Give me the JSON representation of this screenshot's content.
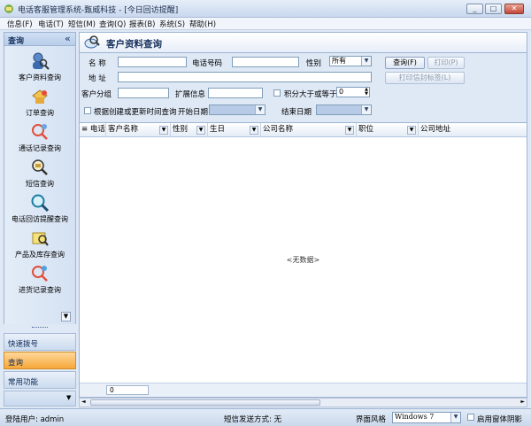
{
  "window": {
    "title": "电话客服管理系统-甄威科技 - [今日回访提醒]",
    "controls": [
      "minimize",
      "maximize",
      "close"
    ]
  },
  "menu": [
    "信息(F)",
    "电话(T)",
    "短信(M)",
    "查询(Q)",
    "报表(B)",
    "系统(S)",
    "帮助(H)"
  ],
  "sidebar": {
    "title": "查询",
    "collapse": "«",
    "items": [
      {
        "label": "客户资料查询",
        "icon": "customer-search-icon"
      },
      {
        "label": "订单查询",
        "icon": "order-icon"
      },
      {
        "label": "通话记录查询",
        "icon": "call-log-icon"
      },
      {
        "label": "短信查询",
        "icon": "sms-icon"
      },
      {
        "label": "电话回访提醒查询",
        "icon": "magnifier-icon"
      },
      {
        "label": "产品及库存查询",
        "icon": "product-icon"
      },
      {
        "label": "进货记录查询",
        "icon": "purchase-icon"
      }
    ],
    "bottom_buttons": [
      {
        "label": "快速拨号",
        "active": false
      },
      {
        "label": "查询",
        "active": true
      },
      {
        "label": "常用功能",
        "active": false
      }
    ]
  },
  "panel": {
    "title": "客户资料查询"
  },
  "form": {
    "name_label": "名 称",
    "name_value": "",
    "phone_label": "电话号码",
    "phone_value": "",
    "gender_label": "性别",
    "gender_value": "所有",
    "address_label": "地 址",
    "address_value": "",
    "group_label": "客户分组",
    "group_value": "",
    "ext_label": "扩展信息",
    "ext_value": "",
    "points_label": "积分大于或等于",
    "points_value": "0",
    "date_check_label": "根据创建或更新时间查询",
    "start_label": "开始日期",
    "end_label": "结束日期",
    "query_btn": "查询(F)",
    "print_btn": "打印(P)",
    "envelope_btn": "打印信封标签(L)"
  },
  "grid": {
    "columns": [
      "电话",
      "客户名称",
      "性别",
      "生日",
      "公司名称",
      "职位",
      "公司地址"
    ],
    "empty_text": "<无数据>",
    "count": "0"
  },
  "statusbar": {
    "user": "登陆用户: admin",
    "sms_mode": "短信发送方式: 无",
    "theme_label": "界面风格",
    "theme_value": "Windows 7",
    "shadow_label": "启用窗体阴影"
  },
  "colors": {
    "accent": "#15305b",
    "active_tab": "#f6a739",
    "background": "#dfe8f5"
  }
}
